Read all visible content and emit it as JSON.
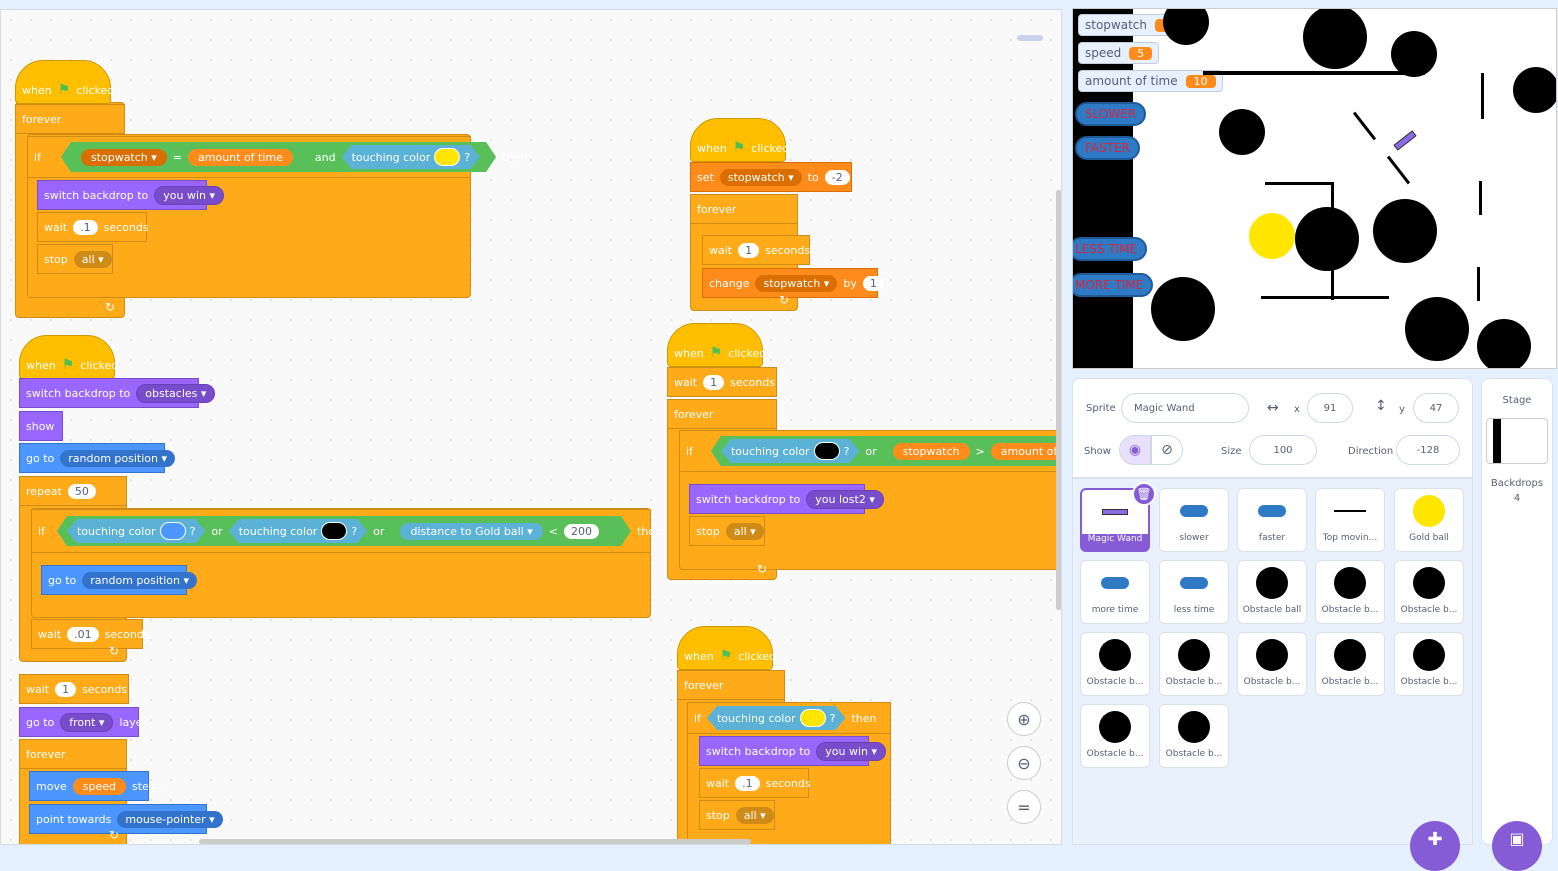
{
  "kw": {
    "when": "when",
    "clicked": "clicked",
    "forever": "forever",
    "if": "if",
    "then": "then",
    "and": "and",
    "or": "or",
    "wait": "wait",
    "seconds": "seconds",
    "stop": "stop",
    "switch_backdrop_to": "switch backdrop to",
    "set": "set",
    "to": "to",
    "change": "change",
    "by": "by",
    "show": "show",
    "go_to": "go to",
    "repeat": "repeat",
    "touching_color": "touching color",
    "distance_to": "distance to",
    "layer": "layer",
    "move": "move",
    "steps": "steps",
    "point_towards": "point towards",
    "q": "?",
    "eq": "=",
    "gt": ">",
    "lt": "<"
  },
  "scripts": {
    "s1": {
      "var1": "stopwatch",
      "var2": "amount of time",
      "backdrop": "you win",
      "wait": ".1",
      "stop": "all"
    },
    "s2": {
      "var": "stopwatch",
      "setval": "-2",
      "wait": "1",
      "change_var": "stopwatch",
      "by": "1"
    },
    "s3": {
      "backdrop": "obstacles",
      "goto": "random position",
      "repeat": "50",
      "sprite": "Gold ball",
      "dist": "200",
      "goto2": "random position",
      "wait": ".01",
      "wait2": "1",
      "layer": "front",
      "move": "speed",
      "point": "mouse-pointer"
    },
    "s4": {
      "wait": "1",
      "var1": "stopwatch",
      "var2": "amount of time",
      "backdrop": "you lost2",
      "stop": "all"
    },
    "s5": {
      "backdrop": "you win",
      "wait": ".1",
      "stop": "all"
    }
  },
  "stage": {
    "monitors": [
      {
        "label": "stopwatch",
        "value": "1"
      },
      {
        "label": "speed",
        "value": "5"
      },
      {
        "label": "amount of time",
        "value": "10"
      }
    ],
    "buttons": [
      "SLOWER",
      "FASTER",
      "LESS TIME",
      "MORE TIME"
    ]
  },
  "sprite_info": {
    "sprite_label": "Sprite",
    "sprite_name": "Magic Wand",
    "x_label": "x",
    "x": "91",
    "y_label": "y",
    "y": "47",
    "show_label": "Show",
    "size_label": "Size",
    "size": "100",
    "direction_label": "Direction",
    "direction": "-128"
  },
  "sprites": [
    "Magic Wand",
    "slower",
    "faster",
    "Top movin...",
    "Gold ball",
    "more time",
    "less time",
    "Obstacle ball",
    "Obstacle b...",
    "Obstacle b...",
    "Obstacle b...",
    "Obstacle b...",
    "Obstacle b...",
    "Obstacle b...",
    "Obstacle b...",
    "Obstacle b...",
    "Obstacle b..."
  ],
  "stage_panel": {
    "title": "Stage",
    "backdrops_label": "Backdrops",
    "backdrops_count": "4"
  },
  "colors": {
    "events": "#ffbf00",
    "control": "#ffab19",
    "looks": "#9966ff",
    "motion": "#4c97ff",
    "sensing": "#5cb1d6",
    "variables": "#ff8c1a",
    "operators": "#59c059"
  }
}
